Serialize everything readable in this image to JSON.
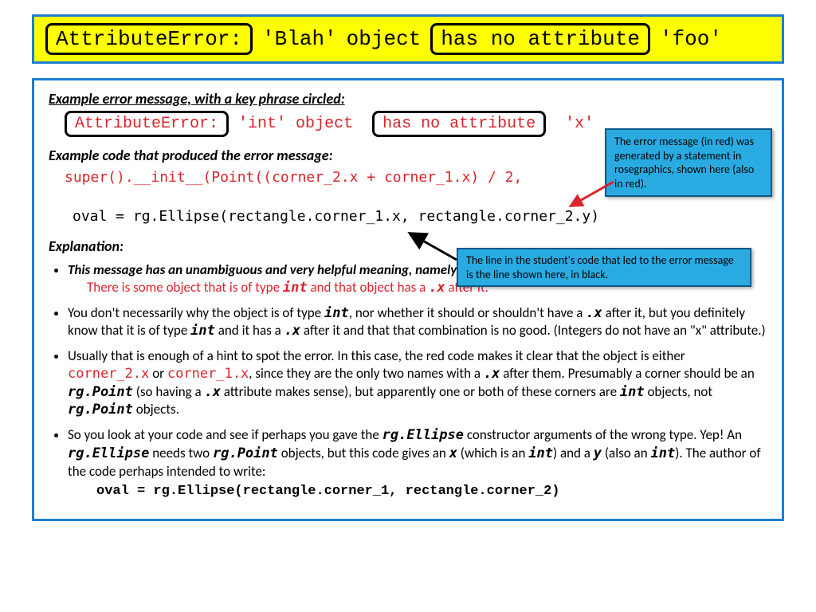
{
  "banner": {
    "boxed1": "AttributeError:",
    "text1": "'Blah'",
    "text2": "object",
    "boxed2": "has no attribute",
    "text3": "'foo'"
  },
  "section1": {
    "heading": "Example error message, with a key phrase circled:",
    "boxed1": "AttributeError:",
    "mid": "'int' object",
    "boxed2": "has no attribute",
    "tail": "'x'"
  },
  "section2": {
    "heading": "Example code that produced the error message:",
    "codeRed": "super().__init__(Point((corner_2.x + corner_1.x) / 2,",
    "codeBlack": "oval = rg.Ellipse(rectangle.corner_1.x, rectangle.corner_2.y)"
  },
  "callout1": "The error message (in red) was generated by a statement in rosegraphics, shown here (also in red).",
  "callout2": "The line in the student's code that led to the error message is the line shown here, in black.",
  "explanationHeading": "Explanation:",
  "bullets": {
    "b1a": "This message has an unambiguous and very helpful meaning, namely:",
    "b1b_pre": "There is some object that is of type  ",
    "b1b_int": "int",
    "b1b_mid": "   and that object has a   ",
    "b1b_dotx": ".x",
    "b1b_post": "      after it.",
    "b2_pre": "You don't necessarily why the object is of type  ",
    "b2_int": "int",
    "b2_mid1": ", nor whether it should or shouldn't have a  ",
    "b2_dotx": ".x",
    "b2_mid2": "   after it, but you definitely know that it is of type  ",
    "b2_int2": "int",
    "b2_mid3": "   and it has a   ",
    "b2_dotx2": ".x",
    "b2_mid4": "   after it and that that combination is no good.  (Integers do not have an \"x\" attribute.)",
    "b3_pre": "Usually that is enough of a hint to spot the error.  In this case, the red code makes it clear that the object is either   ",
    "b3_c1": "corner_2.x",
    "b3_mid1": "   or   ",
    "b3_c2": "corner_1.x",
    "b3_mid2": ", since they are the only two names with a   ",
    "b3_dotx": ".x",
    "b3_mid3": "  after them.  Presumably a corner should be an ",
    "b3_rgp": "rg.Point",
    "b3_mid4": " (so having a   ",
    "b3_dotx2": ".x",
    "b3_mid5": "   attribute makes sense), but apparently one or both of these corners are   ",
    "b3_int": "int",
    "b3_mid6": "  objects, not  ",
    "b3_rgp2": "rg.Point",
    "b3_end": "   objects.",
    "b4_pre": "So you look at your code and see if perhaps you gave the   ",
    "b4_rge": "rg.Ellipse",
    "b4_mid1": "   constructor arguments of the wrong type.  Yep!  An  ",
    "b4_rge2": "rg.Ellipse",
    "b4_mid2": "   needs two  ",
    "b4_rgp": "rg.Point",
    "b4_mid3": "  objects, but this code gives an ",
    "b4_x": "x",
    "b4_mid4": "  (which is an ",
    "b4_int": "int",
    "b4_mid5": ") and a ",
    "b4_y": "y",
    "b4_mid6": " (also an ",
    "b4_int2": "int",
    "b4_mid7": ").  The author of the code perhaps intended to write:",
    "b4_code": "oval = rg.Ellipse(rectangle.corner_1, rectangle.corner_2)"
  }
}
